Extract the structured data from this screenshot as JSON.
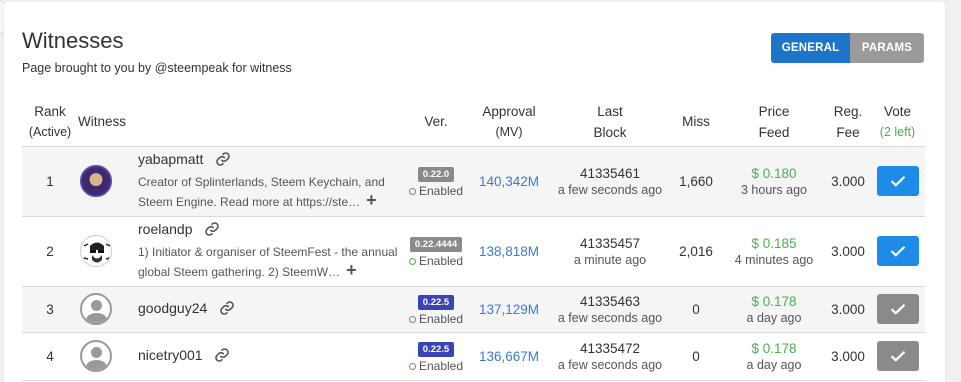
{
  "header": {
    "title": "Witnesses",
    "subtitle": "Page brought to you by @steempeak for witness",
    "tabs": [
      {
        "label": "GENERAL",
        "active": true
      },
      {
        "label": "PARAMS",
        "active": false
      }
    ]
  },
  "columns": {
    "rank": "Rank",
    "rank_sub": "(Active)",
    "witness": "Witness",
    "version": "Ver.",
    "approval": "Approval",
    "approval_sub": "(MV)",
    "last_block_1": "Last",
    "last_block_2": "Block",
    "miss": "Miss",
    "price_feed_1": "Price",
    "price_feed_2": "Feed",
    "reg_fee_1": "Reg.",
    "reg_fee_2": "Fee",
    "vote": "Vote",
    "vote_sub": "(2 left)"
  },
  "rows": [
    {
      "rank": "1",
      "name": "yabapmatt",
      "desc_line1": "Creator of Splinterlands, Steem Keychain, and",
      "desc_line2": "Steem Engine. Read more at https://ste…",
      "version": "0.22.0",
      "status": "Enabled",
      "approval": "140,342M",
      "last_block": "41335461",
      "block_time": "a few seconds ago",
      "miss": "1,660",
      "price": "$ 0.180",
      "price_time": "3 hours ago",
      "reg_fee": "3.000",
      "voted": true
    },
    {
      "rank": "2",
      "name": "roelandp",
      "desc_line1": "1) Initiator & organiser of SteemFest - the annual",
      "desc_line2": "global Steem gathering. 2) SteemW…",
      "version": "0.22.4444",
      "status": "Enabled",
      "approval": "138,818M",
      "last_block": "41335457",
      "block_time": "a minute ago",
      "miss": "2,016",
      "price": "$ 0.185",
      "price_time": "4 minutes ago",
      "reg_fee": "3.000",
      "voted": true
    },
    {
      "rank": "3",
      "name": "goodguy24",
      "version": "0.22.5",
      "status": "Enabled",
      "approval": "137,129M",
      "last_block": "41335463",
      "block_time": "a few seconds ago",
      "miss": "0",
      "price": "$ 0.178",
      "price_time": "a day ago",
      "reg_fee": "3.000",
      "voted": false
    },
    {
      "rank": "4",
      "name": "nicetry001",
      "version": "0.22.5",
      "status": "Enabled",
      "approval": "136,667M",
      "last_block": "41335472",
      "block_time": "a few seconds ago",
      "miss": "0",
      "price": "$ 0.178",
      "price_time": "a day ago",
      "reg_fee": "3.000",
      "voted": false
    }
  ],
  "icons": {
    "link": "link-icon",
    "expand": "plus-icon",
    "vote": "check-icon",
    "status": "enabled-dot-icon"
  },
  "colors": {
    "primary": "#1d74c9",
    "vote_active": "#1f8be8",
    "vote_inactive": "#8a8a8a",
    "approval": "#3a7bd5",
    "price": "#4cae4c",
    "version_old": "#8a8a8a",
    "version_current": "#3a44b8"
  },
  "expand_symbol": "+"
}
